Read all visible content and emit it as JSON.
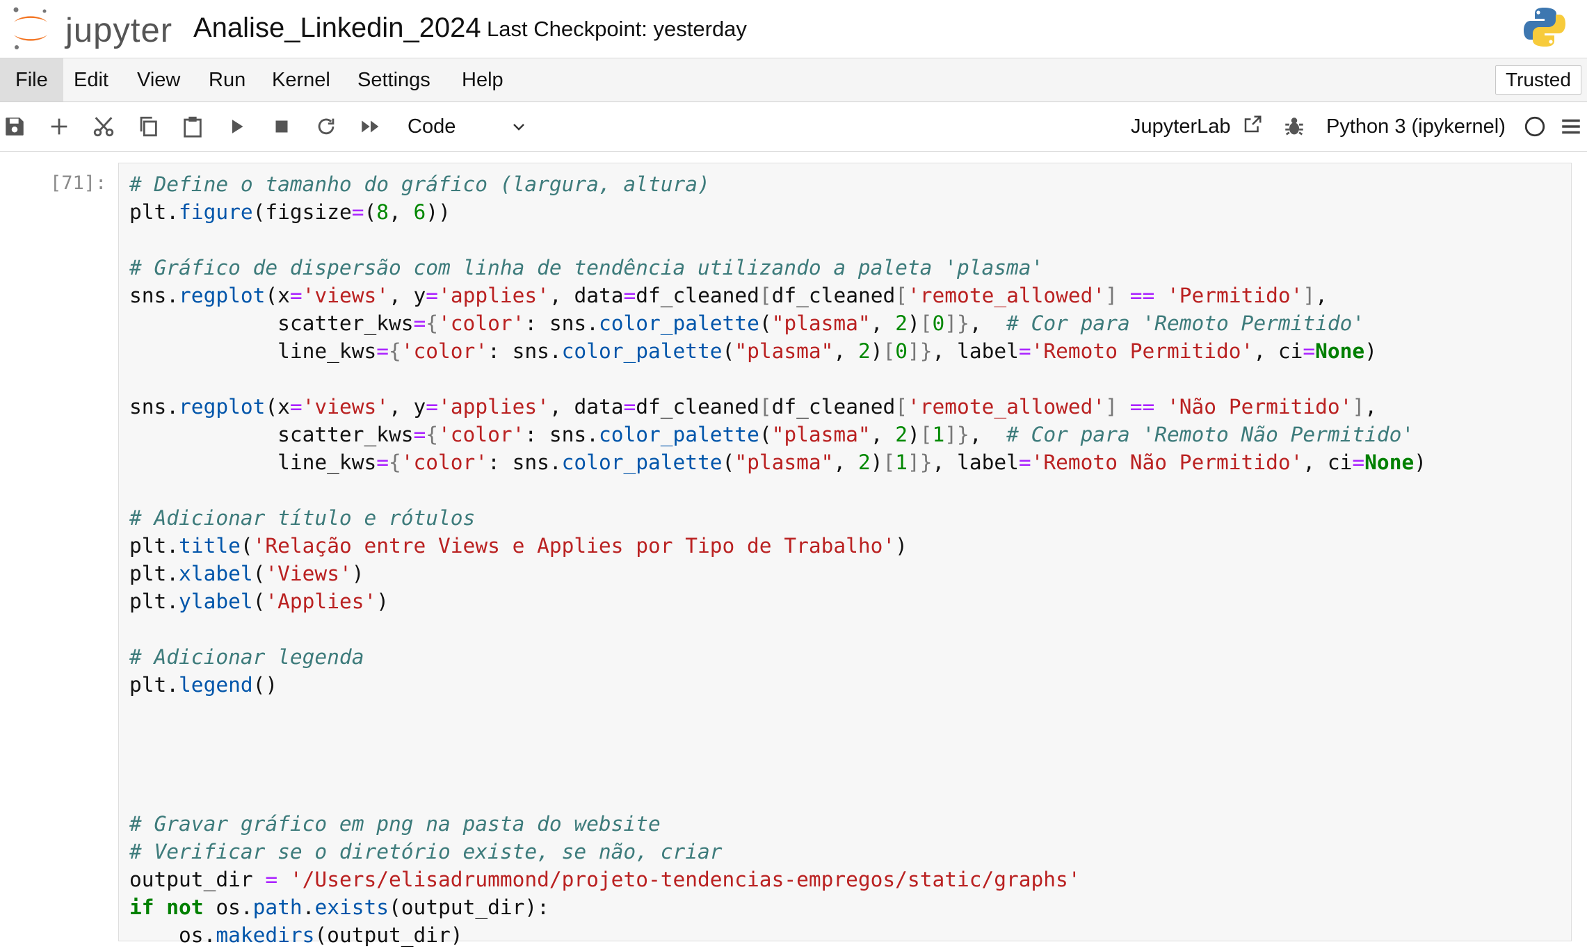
{
  "header": {
    "logo_text": "jupyter",
    "notebook_title": "Analise_Linkedin_2024",
    "checkpoint": "Last Checkpoint: yesterday"
  },
  "menu": {
    "items": [
      "File",
      "Edit",
      "View",
      "Run",
      "Kernel",
      "Settings",
      "Help"
    ],
    "trusted": "Trusted"
  },
  "toolbar": {
    "icons": [
      "save-icon",
      "add-cell-icon",
      "cut-icon",
      "copy-icon",
      "paste-icon",
      "run-icon",
      "stop-icon",
      "restart-icon",
      "fast-forward-icon"
    ],
    "cell_type": "Code",
    "jupyterlab_link": "JupyterLab",
    "kernel_name": "Python 3 (ipykernel)"
  },
  "cell": {
    "prompt": "[71]:",
    "lines": [
      "# Define o tamanho do gráfico (largura, altura)",
      "plt.figure(figsize=(8, 6))",
      "",
      "# Gráfico de dispersão com linha de tendência utilizando a paleta 'plasma'",
      "sns.regplot(x='views', y='applies', data=df_cleaned[df_cleaned['remote_allowed'] == 'Permitido'],",
      "            scatter_kws={'color': sns.color_palette(\"plasma\", 2)[0]},  # Cor para 'Remoto Permitido'",
      "            line_kws={'color': sns.color_palette(\"plasma\", 2)[0]}, label='Remoto Permitido', ci=None)",
      "",
      "sns.regplot(x='views', y='applies', data=df_cleaned[df_cleaned['remote_allowed'] == 'Não Permitido'],",
      "            scatter_kws={'color': sns.color_palette(\"plasma\", 2)[1]},  # Cor para 'Remoto Não Permitido'",
      "            line_kws={'color': sns.color_palette(\"plasma\", 2)[1]}, label='Remoto Não Permitido', ci=None)",
      "",
      "# Adicionar título e rótulos",
      "plt.title('Relação entre Views e Applies por Tipo de Trabalho')",
      "plt.xlabel('Views')",
      "plt.ylabel('Applies')",
      "",
      "# Adicionar legenda",
      "plt.legend()",
      "",
      "",
      "",
      "",
      "# Gravar gráfico em png na pasta do website",
      "# Verificar se o diretório existe, se não, criar",
      "output_dir = '/Users/elisadrummond/projeto-tendencias-empregos/static/graphs'",
      "if not os.path.exists(output_dir):",
      "    os.makedirs(output_dir)"
    ]
  },
  "colors": {
    "comment": "#3d7b7b",
    "string": "#ba2121",
    "keyword": "#008000",
    "function": "#0055aa",
    "number": "#008800",
    "operator": "#aa22ff",
    "jupyter_orange": "#f37726"
  }
}
